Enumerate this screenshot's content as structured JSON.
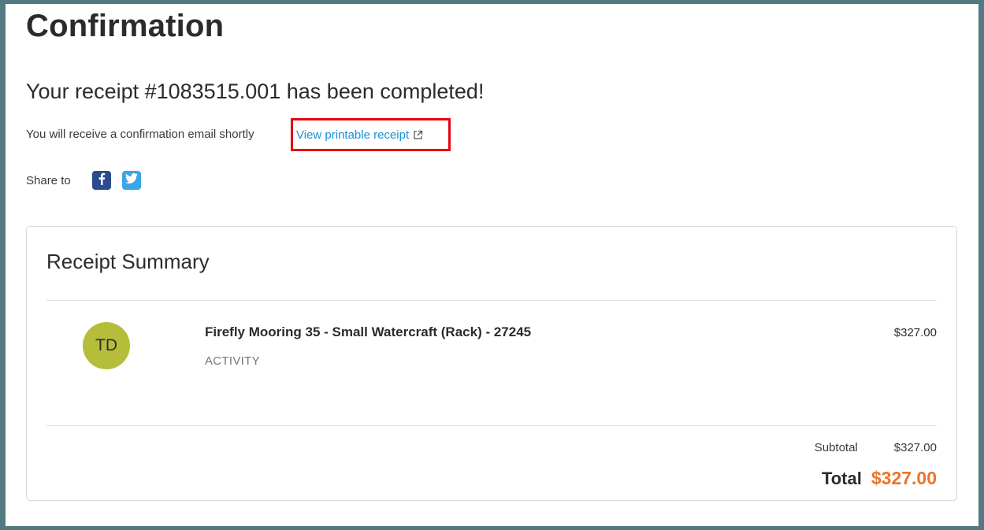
{
  "page": {
    "title": "Confirmation",
    "receipt_heading": "Your receipt #1083515.001 has been completed!",
    "confirmation_text": "You will receive a confirmation email shortly",
    "printable_link": "View printable receipt",
    "share_label": "Share to"
  },
  "icons": {
    "facebook": "facebook-icon",
    "twitter": "twitter-icon",
    "external_link": "external-link-icon"
  },
  "colors": {
    "frame": "#527a80",
    "link": "#1a8fd6",
    "highlight_box": "#e30613",
    "total": "#e8762b",
    "avatar": "#b5be3b",
    "facebook": "#2c4a8e",
    "twitter": "#3aa6e8"
  },
  "summary": {
    "title": "Receipt Summary",
    "items": [
      {
        "initials": "TD",
        "name": "Firefly Mooring 35 - Small Watercraft (Rack) - 27245",
        "type": "ACTIVITY",
        "price": "$327.00"
      }
    ],
    "subtotal_label": "Subtotal",
    "subtotal_value": "$327.00",
    "total_label": "Total",
    "total_value": "$327.00"
  }
}
